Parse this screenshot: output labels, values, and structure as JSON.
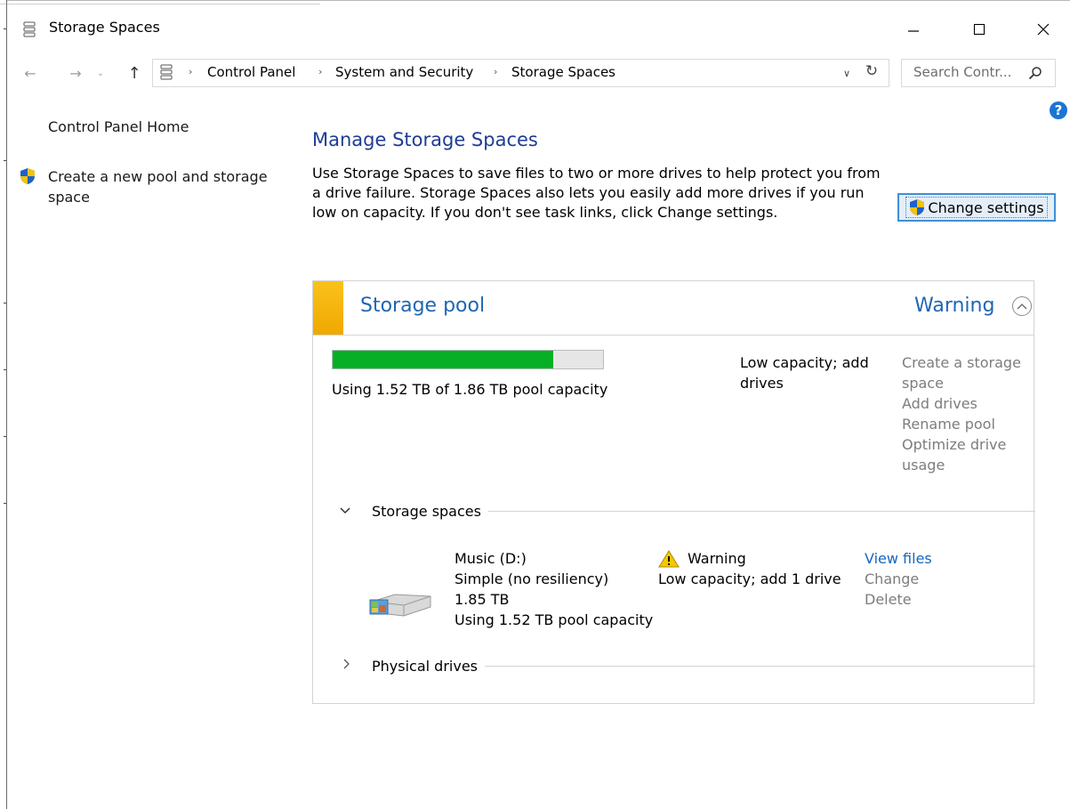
{
  "window": {
    "title": "Storage Spaces",
    "controls": {
      "minimize": "—",
      "maximize": "☐",
      "close": "✕"
    }
  },
  "address_bar": {
    "breadcrumbs": [
      "Control Panel",
      "System and Security",
      "Storage Spaces"
    ],
    "separator": "›",
    "search_placeholder": "Search Contr..."
  },
  "nav": {
    "home_label": "Control Panel Home",
    "create_pool_label": "Create a new pool and storage space"
  },
  "main": {
    "title": "Manage Storage Spaces",
    "description": "Use Storage Spaces to save files to two or more drives to help protect you from a drive failure. Storage Spaces also lets you easily add more drives if you run low on capacity. If you don't see task links, click Change settings.",
    "change_settings_label": "Change settings"
  },
  "pool": {
    "title": "Storage pool",
    "status": "Warning",
    "usage_fraction": 0.817,
    "usage_text": "Using 1.52 TB of 1.86 TB pool capacity",
    "warning_text": "Low capacity; add drives",
    "tasks": [
      "Create a storage space",
      "Add drives",
      "Rename pool",
      "Optimize drive usage"
    ]
  },
  "storage_spaces": {
    "header": "Storage spaces",
    "items": [
      {
        "name": "Music (D:)",
        "resiliency": "Simple (no resiliency)",
        "size": "1.85 TB",
        "usage": "Using 1.52 TB pool capacity",
        "status_title": "Warning",
        "status_detail": "Low capacity; add 1 drive",
        "actions": {
          "view": "View files",
          "change": "Change",
          "delete": "Delete"
        }
      }
    ]
  },
  "physical_drives": {
    "header": "Physical drives"
  },
  "colors": {
    "accent_link": "#1f66b3",
    "title_blue": "#1e3c96",
    "usage_green": "#06b025",
    "warning_accent": "#f9c21c",
    "disabled_grey": "#7d7d7d"
  }
}
